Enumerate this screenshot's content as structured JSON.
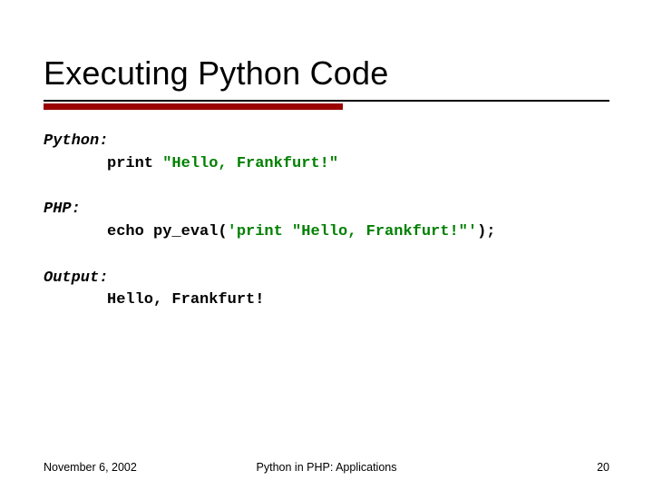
{
  "title": "Executing Python Code",
  "sections": {
    "python": {
      "label": "Python:",
      "code_kw": "print ",
      "code_str": "\"Hello, Frankfurt!\""
    },
    "php": {
      "label": "PHP:",
      "code_kw": "echo py_eval(",
      "code_str": "'print \"Hello, Frankfurt!\"'",
      "code_tail": ");"
    },
    "output": {
      "label": "Output:",
      "text": "Hello, Frankfurt!"
    }
  },
  "footer": {
    "date": "November 6, 2002",
    "center": "Python in PHP: Applications",
    "page": "20"
  },
  "colors": {
    "accent": "#9a0000",
    "string": "#008000"
  }
}
